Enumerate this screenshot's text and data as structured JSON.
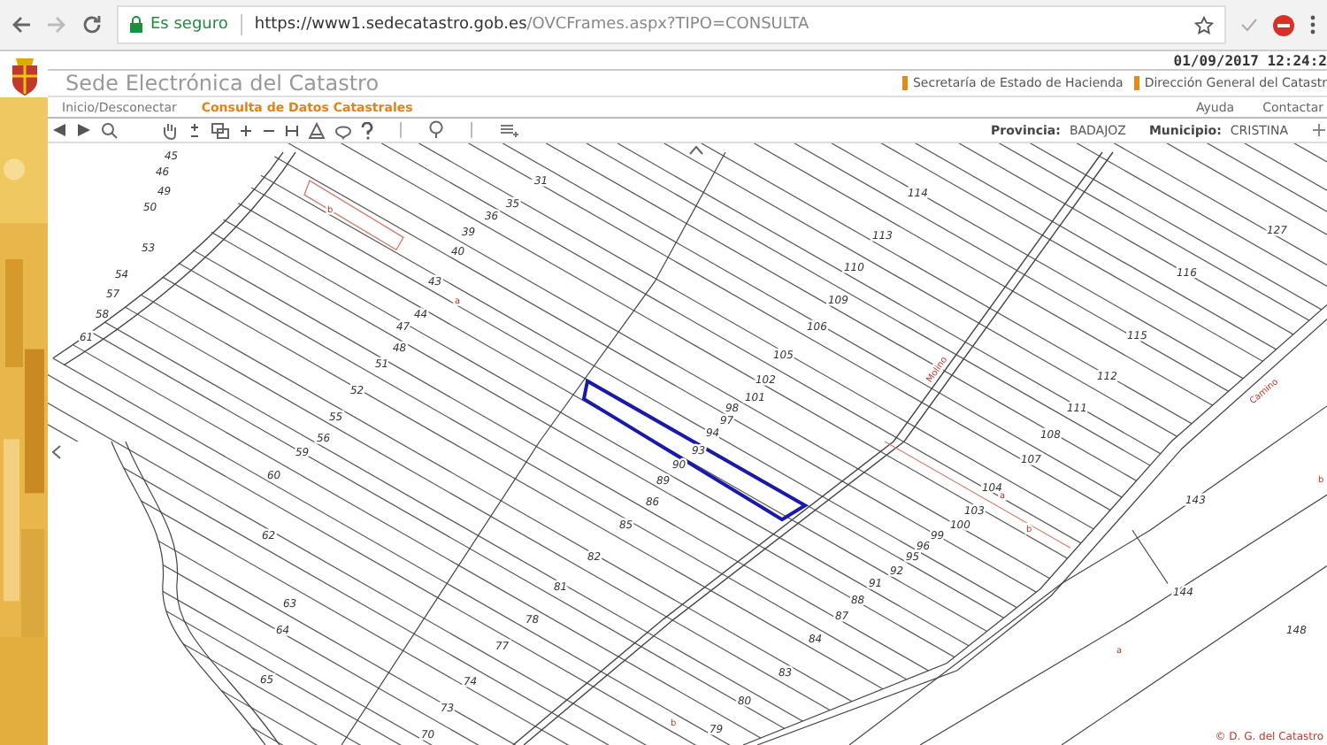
{
  "browser": {
    "security": "Es seguro",
    "url_host": "https://www1.sedecatastro.gob.es",
    "url_path": "/OVCFrames.aspx?TIPO=CONSULTA"
  },
  "header": {
    "datetime": "01/09/2017 12:24:2",
    "title": "Sede Electrónica del Catastro",
    "links": [
      "Secretaría de Estado de Hacienda",
      "Dirección General del Catastr"
    ]
  },
  "nav": {
    "items": [
      {
        "label": "Inicio/Desconectar",
        "selected": false
      },
      {
        "label": "Consulta de Datos Catastrales",
        "selected": true
      }
    ],
    "help": [
      "Ayuda",
      "Contactar"
    ]
  },
  "location": {
    "province_label": "Provincia:",
    "province": "BADAJOZ",
    "municipality_label": "Municipio:",
    "municipality": "CRISTINA"
  },
  "map": {
    "labels": [
      {
        "text": "45",
        "kind": "parcel"
      },
      {
        "text": "46",
        "kind": "parcel"
      },
      {
        "text": "49",
        "kind": "parcel"
      },
      {
        "text": "50",
        "kind": "parcel"
      },
      {
        "text": "53",
        "kind": "parcel"
      },
      {
        "text": "54",
        "kind": "parcel"
      },
      {
        "text": "57",
        "kind": "parcel"
      },
      {
        "text": "58",
        "kind": "parcel"
      },
      {
        "text": "61",
        "kind": "parcel"
      },
      {
        "text": "31",
        "kind": "parcel"
      },
      {
        "text": "35",
        "kind": "parcel"
      },
      {
        "text": "36",
        "kind": "parcel"
      },
      {
        "text": "39",
        "kind": "parcel"
      },
      {
        "text": "40",
        "kind": "parcel"
      },
      {
        "text": "43",
        "kind": "parcel"
      },
      {
        "text": "a",
        "kind": "subparcel"
      },
      {
        "text": "b",
        "kind": "subparcel"
      },
      {
        "text": "44",
        "kind": "parcel"
      },
      {
        "text": "47",
        "kind": "parcel"
      },
      {
        "text": "48",
        "kind": "parcel"
      },
      {
        "text": "51",
        "kind": "parcel"
      },
      {
        "text": "52",
        "kind": "parcel"
      },
      {
        "text": "55",
        "kind": "parcel"
      },
      {
        "text": "56",
        "kind": "parcel"
      },
      {
        "text": "59",
        "kind": "parcel"
      },
      {
        "text": "60",
        "kind": "parcel"
      },
      {
        "text": "62",
        "kind": "parcel"
      },
      {
        "text": "63",
        "kind": "parcel"
      },
      {
        "text": "64",
        "kind": "parcel"
      },
      {
        "text": "65",
        "kind": "parcel"
      },
      {
        "text": "70",
        "kind": "parcel"
      },
      {
        "text": "73",
        "kind": "parcel"
      },
      {
        "text": "74",
        "kind": "parcel"
      },
      {
        "text": "77",
        "kind": "parcel"
      },
      {
        "text": "78",
        "kind": "parcel"
      },
      {
        "text": "81",
        "kind": "parcel"
      },
      {
        "text": "82",
        "kind": "parcel"
      },
      {
        "text": "85",
        "kind": "parcel"
      },
      {
        "text": "86",
        "kind": "parcel"
      },
      {
        "text": "89",
        "kind": "parcel"
      },
      {
        "text": "90",
        "kind": "parcel"
      },
      {
        "text": "93",
        "kind": "parcel"
      },
      {
        "text": "94",
        "kind": "parcel"
      },
      {
        "text": "97",
        "kind": "parcel"
      },
      {
        "text": "98",
        "kind": "parcel"
      },
      {
        "text": "101",
        "kind": "parcel"
      },
      {
        "text": "102",
        "kind": "parcel"
      },
      {
        "text": "105",
        "kind": "parcel"
      },
      {
        "text": "106",
        "kind": "parcel"
      },
      {
        "text": "109",
        "kind": "parcel"
      },
      {
        "text": "110",
        "kind": "parcel"
      },
      {
        "text": "113",
        "kind": "parcel"
      },
      {
        "text": "114",
        "kind": "parcel"
      },
      {
        "text": "127",
        "kind": "parcel"
      },
      {
        "text": "116",
        "kind": "parcel"
      },
      {
        "text": "115",
        "kind": "parcel"
      },
      {
        "text": "112",
        "kind": "parcel"
      },
      {
        "text": "111",
        "kind": "parcel"
      },
      {
        "text": "108",
        "kind": "parcel"
      },
      {
        "text": "107",
        "kind": "parcel"
      },
      {
        "text": "104",
        "kind": "parcel"
      },
      {
        "text": "a",
        "kind": "subparcel"
      },
      {
        "text": "103",
        "kind": "parcel"
      },
      {
        "text": "b",
        "kind": "subparcel"
      },
      {
        "text": "100",
        "kind": "parcel"
      },
      {
        "text": "99",
        "kind": "parcel"
      },
      {
        "text": "96",
        "kind": "parcel"
      },
      {
        "text": "95",
        "kind": "parcel"
      },
      {
        "text": "92",
        "kind": "parcel"
      },
      {
        "text": "91",
        "kind": "parcel"
      },
      {
        "text": "88",
        "kind": "parcel"
      },
      {
        "text": "87",
        "kind": "parcel"
      },
      {
        "text": "84",
        "kind": "parcel"
      },
      {
        "text": "83",
        "kind": "parcel"
      },
      {
        "text": "80",
        "kind": "parcel"
      },
      {
        "text": "79",
        "kind": "parcel"
      },
      {
        "text": "b",
        "kind": "subparcel"
      },
      {
        "text": "143",
        "kind": "parcel"
      },
      {
        "text": "144",
        "kind": "parcel"
      },
      {
        "text": "148",
        "kind": "parcel"
      },
      {
        "text": "a",
        "kind": "subparcel"
      },
      {
        "text": "b",
        "kind": "subparcel"
      },
      {
        "text": "Camino",
        "kind": "street"
      },
      {
        "text": "Molino",
        "kind": "street"
      }
    ],
    "copyright": "© D. G. del Catastro"
  }
}
